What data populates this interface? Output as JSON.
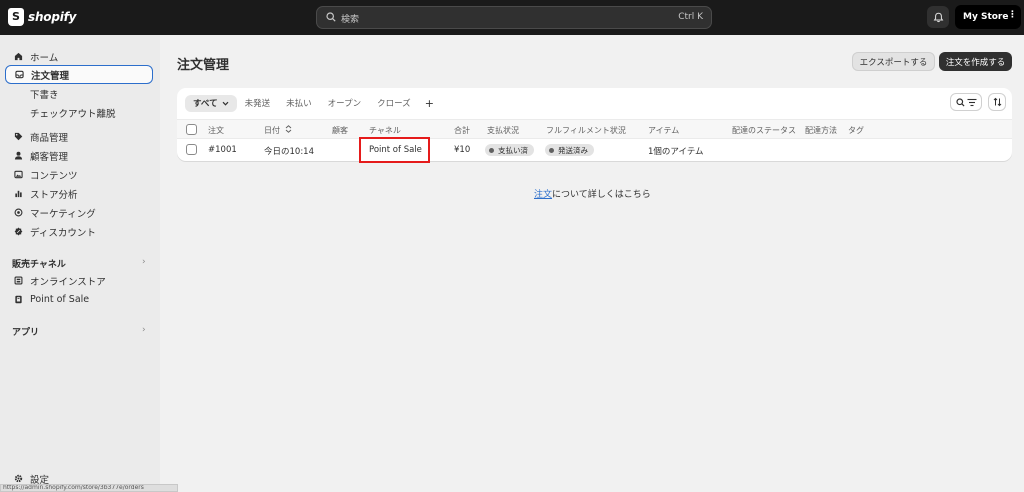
{
  "topbar": {
    "logo_text": "shopify",
    "search_placeholder": "検索",
    "search_shortcut": "Ctrl K",
    "store_name": "My Store",
    "store_menu": "⋮"
  },
  "sidebar": {
    "items": [
      {
        "label": "ホーム",
        "icon": "home-icon"
      },
      {
        "label": "注文管理",
        "icon": "inbox-icon"
      },
      {
        "label": "商品管理",
        "icon": "tag-icon"
      },
      {
        "label": "顧客管理",
        "icon": "person-icon"
      },
      {
        "label": "コンテンツ",
        "icon": "image-icon"
      },
      {
        "label": "ストア分析",
        "icon": "bar-chart-icon"
      },
      {
        "label": "マーケティング",
        "icon": "target-icon"
      },
      {
        "label": "ディスカウント",
        "icon": "discount-icon"
      }
    ],
    "sub_items": [
      "下書き",
      "チェックアウト離脱"
    ],
    "sales_channels_label": "販売チャネル",
    "channels": [
      {
        "label": "オンラインストア",
        "icon": "store-icon"
      },
      {
        "label": "Point of Sale",
        "icon": "pos-icon"
      }
    ],
    "apps_label": "アプリ",
    "settings_label": "設定",
    "chevron": "›"
  },
  "statusbar_url": "https://admin.shopify.com/store/3b377e/orders",
  "main": {
    "title": "注文管理",
    "export_label": "エクスポートする",
    "create_label": "注文を作成する",
    "tabs": [
      "すべて",
      "未発送",
      "未払い",
      "オープン",
      "クローズ"
    ],
    "add_tab": "+",
    "columns": [
      "注文",
      "日付",
      "顧客",
      "チャネル",
      "合計",
      "支払状況",
      "フルフィルメント状況",
      "アイテム",
      "配達のステータス",
      "配達方法",
      "タグ"
    ],
    "rows": [
      {
        "order": "#1001",
        "date": "今日の10:14",
        "customer": "",
        "channel": "Point of Sale",
        "total": "¥10",
        "payment": "支払い済",
        "fulfillment": "発送済み",
        "items": "1個のアイテム",
        "delivery_status": "",
        "delivery_method": "",
        "tags": ""
      }
    ],
    "learn_link": "注文",
    "learn_suffix": "について詳しくはこちら"
  },
  "colors": {
    "topbar": "#1a1a1a",
    "primary_button": "#303030",
    "highlight": "#e51b1b",
    "link": "#2c6ecb",
    "active_outline": "#2c6ecb"
  }
}
